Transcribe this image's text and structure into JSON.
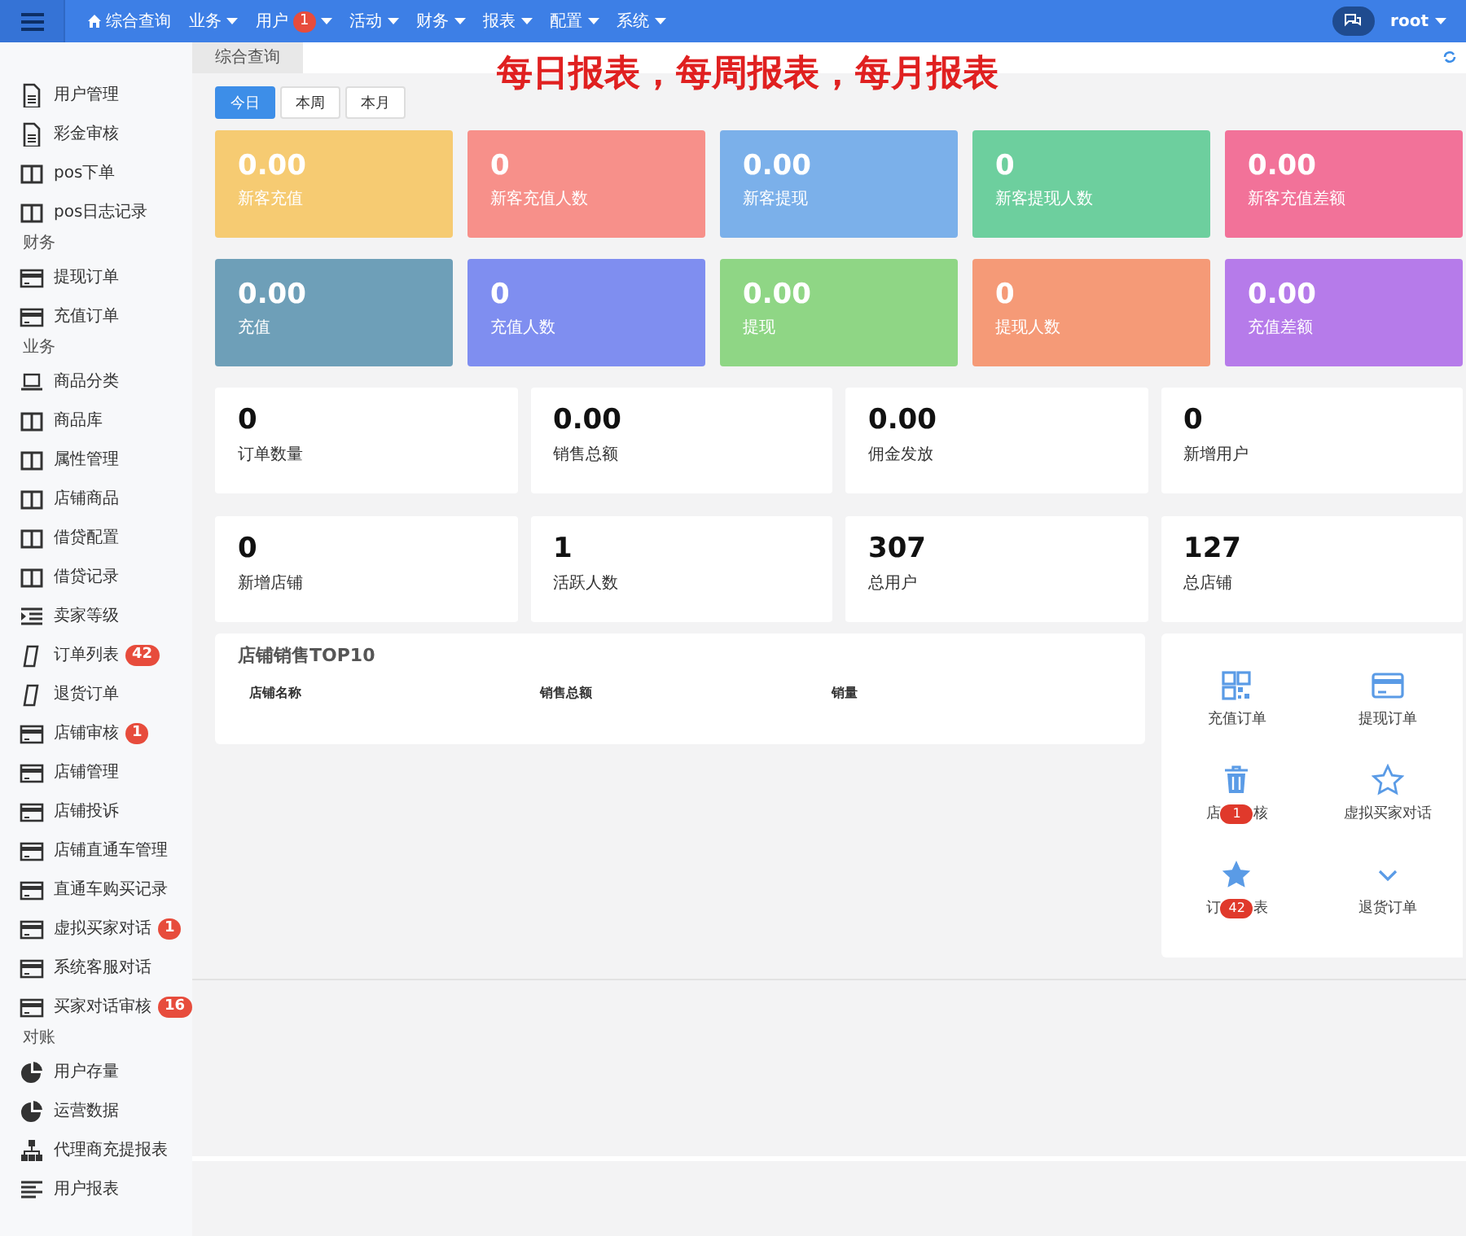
{
  "topbar": {
    "nav": [
      {
        "label": "综合查询",
        "home": true,
        "dropdown": false
      },
      {
        "label": "业务",
        "dropdown": true
      },
      {
        "label": "用户",
        "badge": "1",
        "dropdown": true
      },
      {
        "label": "活动",
        "dropdown": true
      },
      {
        "label": "财务",
        "dropdown": true
      },
      {
        "label": "报表",
        "dropdown": true
      },
      {
        "label": "配置",
        "dropdown": true
      },
      {
        "label": "系统",
        "dropdown": true
      }
    ],
    "user": "root"
  },
  "sidebar": {
    "sections": [
      {
        "items": [
          {
            "label": "用户管理",
            "kind": "doc"
          },
          {
            "label": "彩金审核",
            "kind": "doc"
          },
          {
            "label": "pos下单",
            "kind": "columns"
          },
          {
            "label": "pos日志记录",
            "kind": "columns"
          }
        ]
      },
      {
        "header": "财务",
        "items": [
          {
            "label": "提现订单",
            "kind": "card"
          },
          {
            "label": "充值订单",
            "kind": "card"
          }
        ]
      },
      {
        "header": "业务",
        "items": [
          {
            "label": "商品分类",
            "kind": "laptop"
          },
          {
            "label": "商品库",
            "kind": "columns"
          },
          {
            "label": "属性管理",
            "kind": "columns"
          },
          {
            "label": "店铺商品",
            "kind": "columns"
          },
          {
            "label": "借贷配置",
            "kind": "columns"
          },
          {
            "label": "借贷记录",
            "kind": "columns"
          },
          {
            "label": "卖家等级",
            "kind": "list"
          },
          {
            "label": "订单列表",
            "kind": "phone",
            "badge": "42"
          },
          {
            "label": "退货订单",
            "kind": "phone"
          },
          {
            "label": "店铺审核",
            "kind": "card",
            "badge": "1"
          },
          {
            "label": "店铺管理",
            "kind": "card"
          },
          {
            "label": "店铺投诉",
            "kind": "card"
          },
          {
            "label": "店铺直通车管理",
            "kind": "card"
          },
          {
            "label": "直通车购买记录",
            "kind": "card"
          },
          {
            "label": "虚拟买家对话",
            "kind": "card",
            "badge": "1"
          },
          {
            "label": "系统客服对话",
            "kind": "card"
          },
          {
            "label": "买家对话审核",
            "kind": "card",
            "badge": "16"
          }
        ]
      },
      {
        "header": "对账",
        "items": [
          {
            "label": "用户存量",
            "kind": "pie"
          },
          {
            "label": "运营数据",
            "kind": "pie"
          },
          {
            "label": "代理商充提报表",
            "kind": "sitemap"
          },
          {
            "label": "用户报表",
            "kind": "lines"
          }
        ]
      }
    ]
  },
  "page_tab": "综合查询",
  "headline": "每日报表，每周报表，每月报表",
  "periods": [
    {
      "label": "今日",
      "selected": true
    },
    {
      "label": "本周",
      "selected": false
    },
    {
      "label": "本月",
      "selected": false
    }
  ],
  "color_cards": [
    {
      "value": "0.00",
      "label": "新客充值",
      "color": "#f6cb72"
    },
    {
      "value": "0",
      "label": "新客充值人数",
      "color": "#f7908a"
    },
    {
      "value": "0.00",
      "label": "新客提现",
      "color": "#7bb0ea"
    },
    {
      "value": "0",
      "label": "新客提现人数",
      "color": "#6dcf9e"
    },
    {
      "value": "0.00",
      "label": "新客充值差额",
      "color": "#f27299"
    },
    {
      "value": "0.00",
      "label": "充值",
      "color": "#6e9fb8"
    },
    {
      "value": "0",
      "label": "充值人数",
      "color": "#7f8ef0"
    },
    {
      "value": "0.00",
      "label": "提现",
      "color": "#8fd685"
    },
    {
      "value": "0",
      "label": "提现人数",
      "color": "#f59a77"
    },
    {
      "value": "0.00",
      "label": "充值差额",
      "color": "#b67bea"
    }
  ],
  "stat_cards": [
    {
      "value": "0",
      "label": "订单数量"
    },
    {
      "value": "0.00",
      "label": "销售总额"
    },
    {
      "value": "0.00",
      "label": "佣金发放"
    },
    {
      "value": "0",
      "label": "新增用户"
    },
    {
      "value": "0",
      "label": "新增店铺"
    },
    {
      "value": "1",
      "label": "活跃人数"
    },
    {
      "value": "307",
      "label": "总用户"
    },
    {
      "value": "127",
      "label": "总店铺"
    }
  ],
  "top10": {
    "title": "店铺销售TOP10",
    "columns": [
      "店铺名称",
      "销售总额",
      "销量"
    ]
  },
  "shortcuts": [
    {
      "kind": "qrcode",
      "label": "充值订单"
    },
    {
      "kind": "card",
      "label": "提现订单"
    },
    {
      "kind": "trash",
      "label_start": "店",
      "label_end": "核",
      "badge": "1"
    },
    {
      "kind": "star-outline",
      "label": "虚拟买家对话"
    },
    {
      "kind": "star",
      "label_start": "订",
      "label_end": "表",
      "badge": "42"
    },
    {
      "kind": "chevron",
      "label": "退货订单"
    }
  ]
}
